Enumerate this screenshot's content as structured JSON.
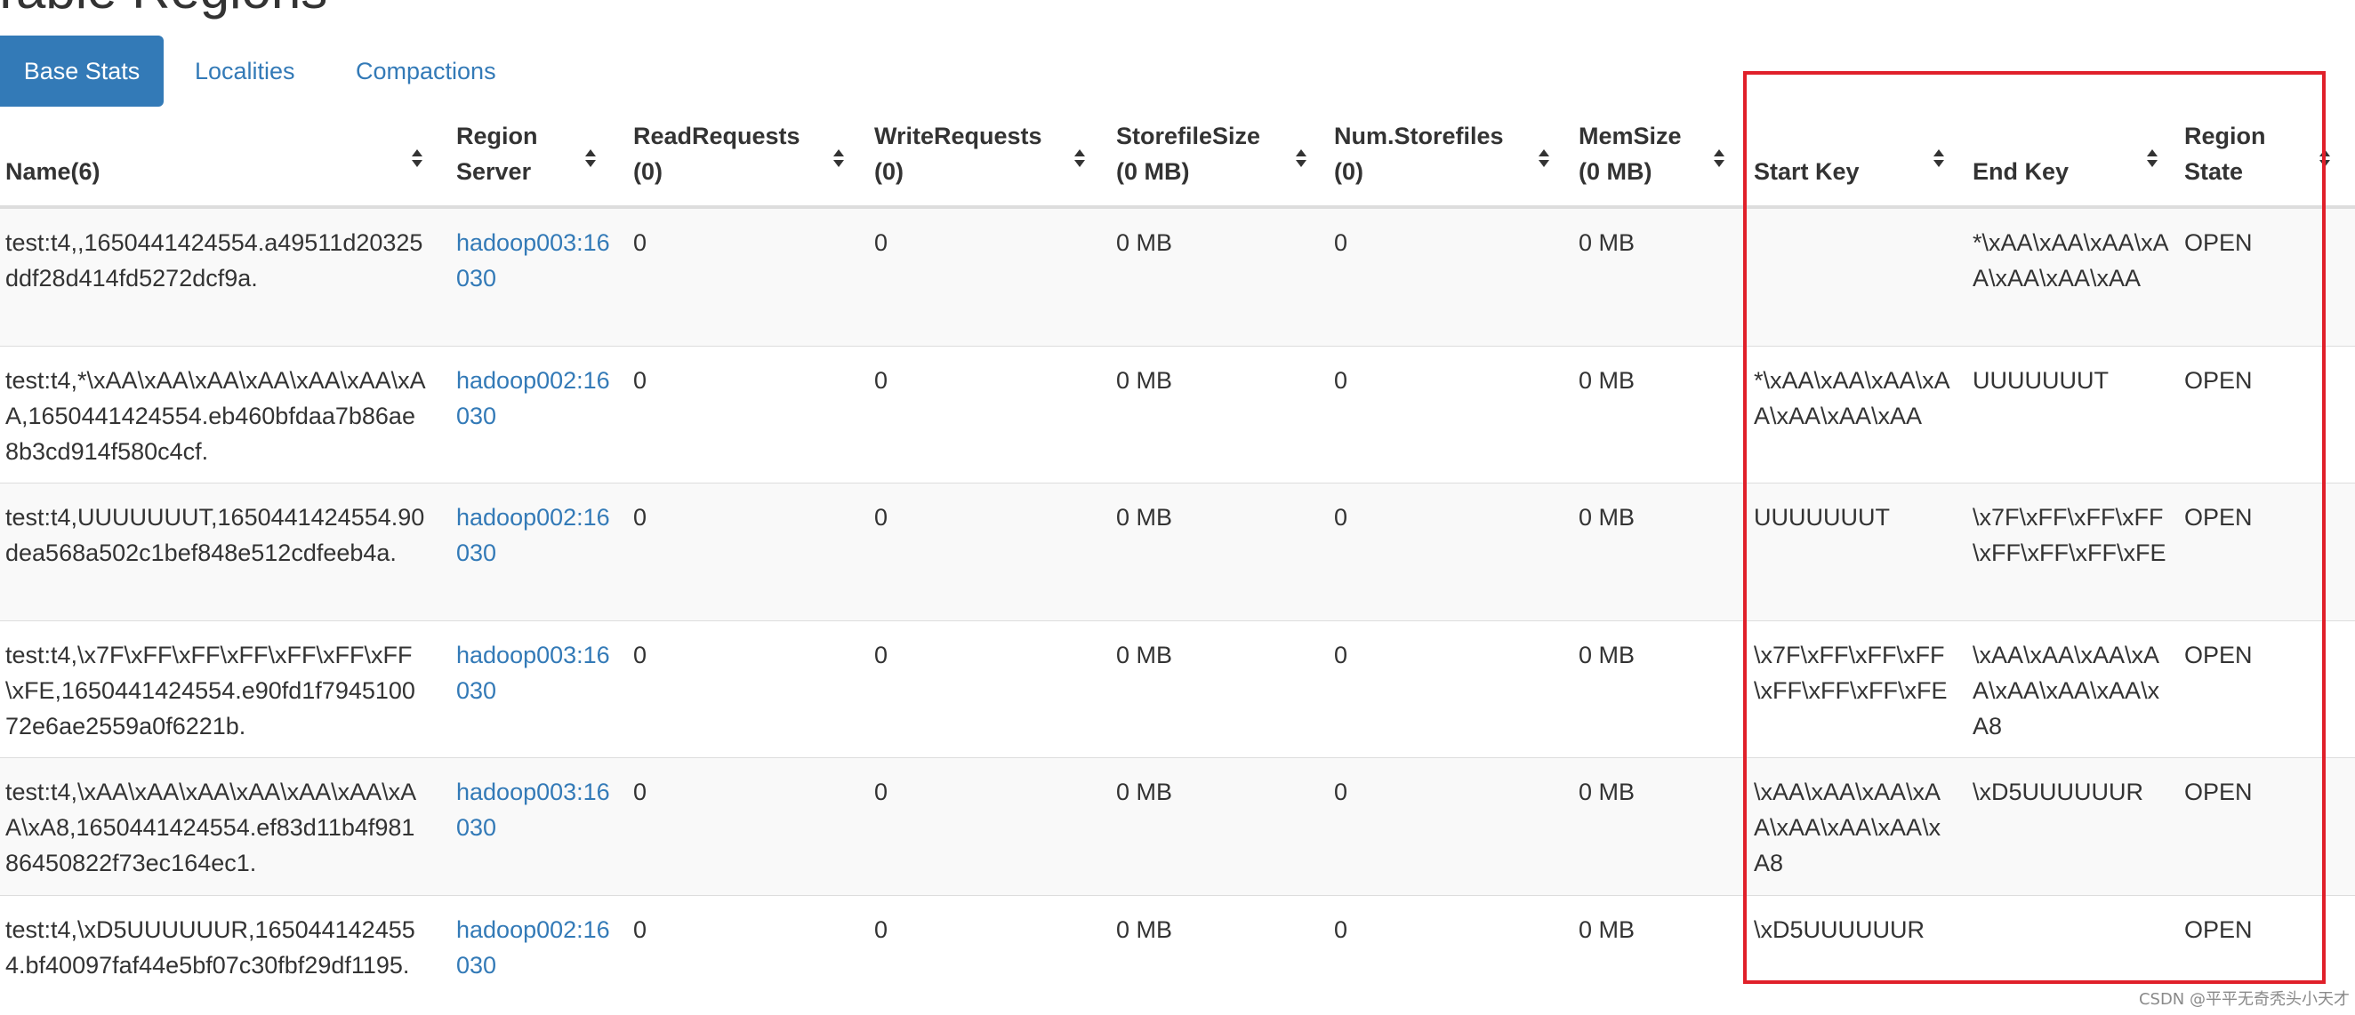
{
  "page": {
    "title": "Table Regions"
  },
  "tabs": [
    {
      "label": "Base Stats",
      "active": true
    },
    {
      "label": "Localities",
      "active": false
    },
    {
      "label": "Compactions",
      "active": false
    }
  ],
  "columns": [
    {
      "line1": "",
      "line2": "Name(6)"
    },
    {
      "line1": "Region",
      "line2": "Server"
    },
    {
      "line1": "ReadRequests",
      "line2": "(0)"
    },
    {
      "line1": "WriteRequests",
      "line2": "(0)"
    },
    {
      "line1": "StorefileSize",
      "line2": "(0 MB)"
    },
    {
      "line1": "Num.Storefiles",
      "line2": "(0)"
    },
    {
      "line1": "MemSize",
      "line2": "(0 MB)"
    },
    {
      "line1": "",
      "line2": "Start Key"
    },
    {
      "line1": "",
      "line2": "End Key"
    },
    {
      "line1": "Region",
      "line2": "State"
    }
  ],
  "rows": [
    {
      "name": "test:t4,,1650441424554.a49511d20325ddf28d414fd5272dcf9a.",
      "server": "hadoop003:16030",
      "read": "0",
      "write": "0",
      "storefile_size": "0 MB",
      "num_storefiles": "0",
      "memsize": "0 MB",
      "start_key": "",
      "end_key": "*\\xAA\\xAA\\xAA\\xAA\\xAA\\xAA\\xAA",
      "state": "OPEN"
    },
    {
      "name": "test:t4,*\\xAA\\xAA\\xAA\\xAA\\xAA\\xAA\\xAA,1650441424554.eb460bfdaa7b86ae8b3cd914f580c4cf.",
      "server": "hadoop002:16030",
      "read": "0",
      "write": "0",
      "storefile_size": "0 MB",
      "num_storefiles": "0",
      "memsize": "0 MB",
      "start_key": "*\\xAA\\xAA\\xAA\\xAA\\xAA\\xAA\\xAA",
      "end_key": "UUUUUUUT",
      "state": "OPEN"
    },
    {
      "name": "test:t4,UUUUUUUT,1650441424554.90dea568a502c1bef848e512cdfeeb4a.",
      "server": "hadoop002:16030",
      "read": "0",
      "write": "0",
      "storefile_size": "0 MB",
      "num_storefiles": "0",
      "memsize": "0 MB",
      "start_key": "UUUUUUUT",
      "end_key": "\\x7F\\xFF\\xFF\\xFF\\xFF\\xFF\\xFF\\xFE",
      "state": "OPEN"
    },
    {
      "name": "test:t4,\\x7F\\xFF\\xFF\\xFF\\xFF\\xFF\\xFF\\xFE,1650441424554.e90fd1f794510072e6ae2559a0f6221b.",
      "server": "hadoop003:16030",
      "read": "0",
      "write": "0",
      "storefile_size": "0 MB",
      "num_storefiles": "0",
      "memsize": "0 MB",
      "start_key": "\\x7F\\xFF\\xFF\\xFF\\xFF\\xFF\\xFF\\xFE",
      "end_key": "\\xAA\\xAA\\xAA\\xAA\\xAA\\xAA\\xAA\\xA8",
      "state": "OPEN"
    },
    {
      "name": "test:t4,\\xAA\\xAA\\xAA\\xAA\\xAA\\xAA\\xAA\\xA8,1650441424554.ef83d11b4f98186450822f73ec164ec1.",
      "server": "hadoop003:16030",
      "read": "0",
      "write": "0",
      "storefile_size": "0 MB",
      "num_storefiles": "0",
      "memsize": "0 MB",
      "start_key": "\\xAA\\xAA\\xAA\\xAA\\xAA\\xAA\\xAA\\xA8",
      "end_key": "\\xD5UUUUUUR",
      "state": "OPEN"
    },
    {
      "name": "test:t4,\\xD5UUUUUUR,1650441424554.bf40097faf44e5bf07c30fbf29df1195.",
      "server": "hadoop002:16030",
      "read": "0",
      "write": "0",
      "storefile_size": "0 MB",
      "num_storefiles": "0",
      "memsize": "0 MB",
      "start_key": "\\xD5UUUUUUR",
      "end_key": "",
      "state": "OPEN"
    }
  ],
  "watermark": "CSDN @平平无奇秃头小天才",
  "colors": {
    "accent": "#337ab7",
    "highlight": "#e0202a",
    "stripe": "#f9f9f9"
  }
}
